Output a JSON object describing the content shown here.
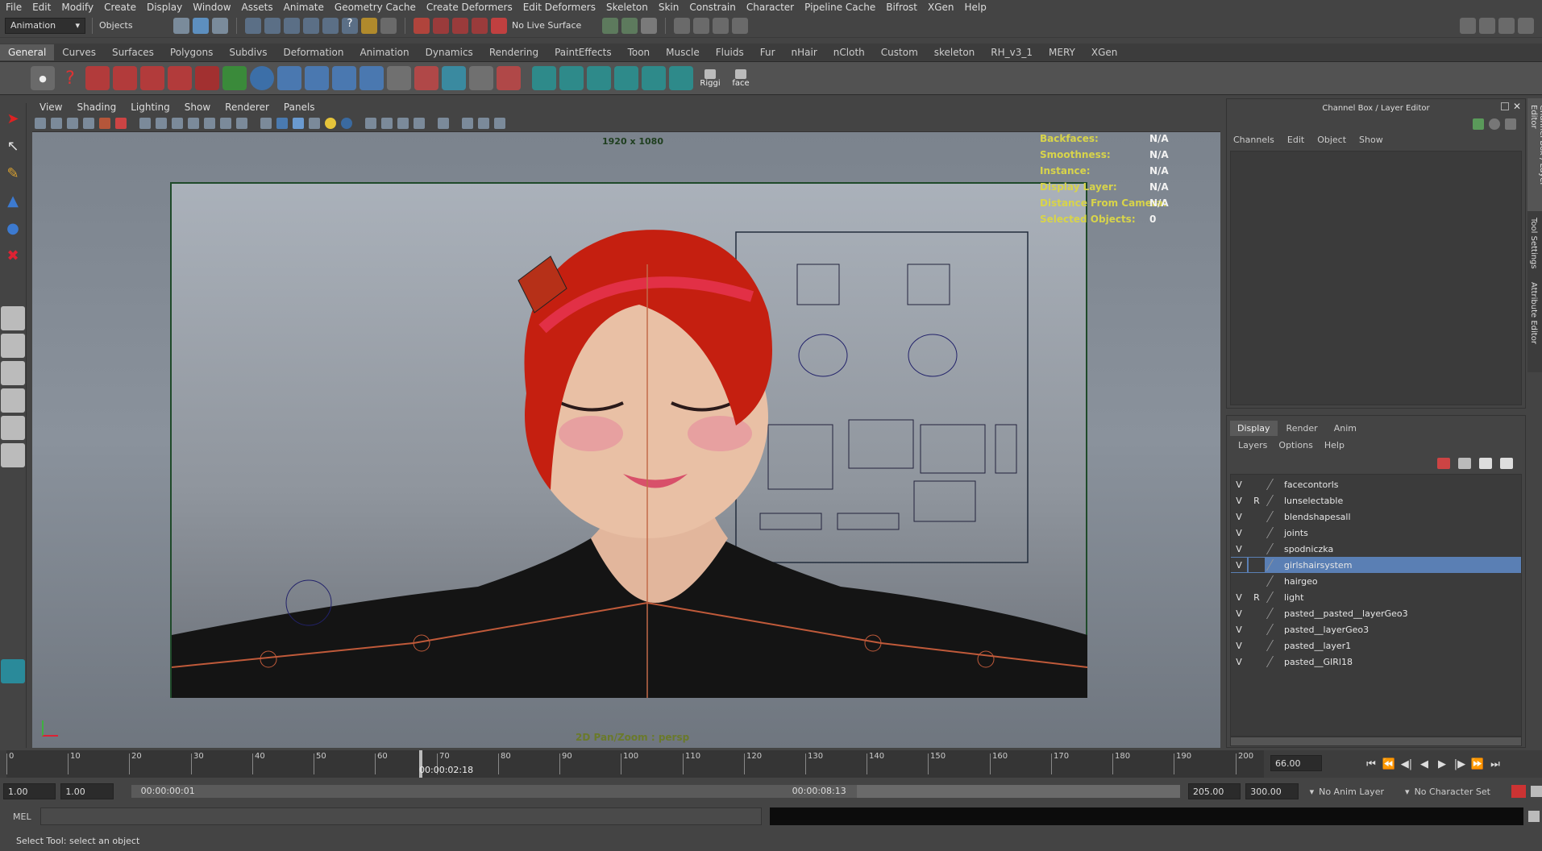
{
  "menubar": [
    "File",
    "Edit",
    "Modify",
    "Create",
    "Display",
    "Window",
    "Assets",
    "Animate",
    "Geometry Cache",
    "Create Deformers",
    "Edit Deformers",
    "Skeleton",
    "Skin",
    "Constrain",
    "Character",
    "Pipeline Cache",
    "Bifrost",
    "XGen",
    "Help"
  ],
  "status": {
    "mode": "Animation",
    "objects_label": "Objects",
    "live_surface": "No Live Surface"
  },
  "shelf_tabs": [
    "General",
    "Curves",
    "Surfaces",
    "Polygons",
    "Subdivs",
    "Deformation",
    "Animation",
    "Dynamics",
    "Rendering",
    "PaintEffects",
    "Toon",
    "Muscle",
    "Fluids",
    "Fur",
    "nHair",
    "nCloth",
    "Custom",
    "skeleton",
    "RH_v3_1",
    "MERY",
    "XGen"
  ],
  "shelf_active": "General",
  "shelf_labels": {
    "riggi": "Riggi",
    "face": "face"
  },
  "panel_menu": [
    "View",
    "Shading",
    "Lighting",
    "Show",
    "Renderer",
    "Panels"
  ],
  "viewport": {
    "resolution": "1920 x 1080",
    "camera_label": "2D Pan/Zoom : persp",
    "hud": [
      {
        "label": "Backfaces:",
        "value": "N/A"
      },
      {
        "label": "Smoothness:",
        "value": "N/A"
      },
      {
        "label": "Instance:",
        "value": "N/A"
      },
      {
        "label": "Display Layer:",
        "value": "N/A"
      },
      {
        "label": "Distance From Camera:",
        "value": "N/A"
      },
      {
        "label": "Selected Objects:",
        "value": "0"
      }
    ]
  },
  "channel_box": {
    "title": "Channel Box / Layer Editor",
    "menus": [
      "Channels",
      "Edit",
      "Object",
      "Show"
    ]
  },
  "side_tabs": [
    "Channel Box / Layer Editor",
    "Tool Settings",
    "Attribute Editor"
  ],
  "layer_editor": {
    "tabs": [
      "Display",
      "Render",
      "Anim"
    ],
    "active_tab": "Display",
    "menus": [
      "Layers",
      "Options",
      "Help"
    ],
    "layers": [
      {
        "v": "V",
        "r": "",
        "name": "facecontorls"
      },
      {
        "v": "V",
        "r": "R",
        "name": "lunselectable"
      },
      {
        "v": "V",
        "r": "",
        "name": "blendshapesall"
      },
      {
        "v": "V",
        "r": "",
        "name": "joints"
      },
      {
        "v": "V",
        "r": "",
        "name": "spodniczka"
      },
      {
        "v": "V",
        "r": "",
        "name": "girlshairsystem",
        "selected": true
      },
      {
        "v": "",
        "r": "",
        "name": "hairgeo"
      },
      {
        "v": "V",
        "r": "R",
        "name": "light"
      },
      {
        "v": "V",
        "r": "",
        "name": "pasted__pasted__layerGeo3"
      },
      {
        "v": "V",
        "r": "",
        "name": "pasted__layerGeo3"
      },
      {
        "v": "V",
        "r": "",
        "name": "pasted__layer1"
      },
      {
        "v": "V",
        "r": "",
        "name": "pasted__GIRl18"
      }
    ]
  },
  "timeline": {
    "ticks": [
      "0",
      "10",
      "20",
      "30",
      "40",
      "50",
      "60",
      "70",
      "80",
      "90",
      "100",
      "110",
      "120",
      "130",
      "140",
      "150",
      "160",
      "170",
      "180",
      "190",
      "200"
    ],
    "current_time": "00:00:02:18",
    "current_frame": "66.00"
  },
  "range": {
    "start": "1.00",
    "start2": "1.00",
    "range_start_time": "00:00:00:01",
    "range_end_time": "00:00:08:13",
    "end": "205.00",
    "end2": "300.00",
    "anim_layer": "No Anim Layer",
    "character_set": "No Character Set"
  },
  "cmdline": {
    "label": "MEL"
  },
  "helpline": "Select Tool: select an object"
}
